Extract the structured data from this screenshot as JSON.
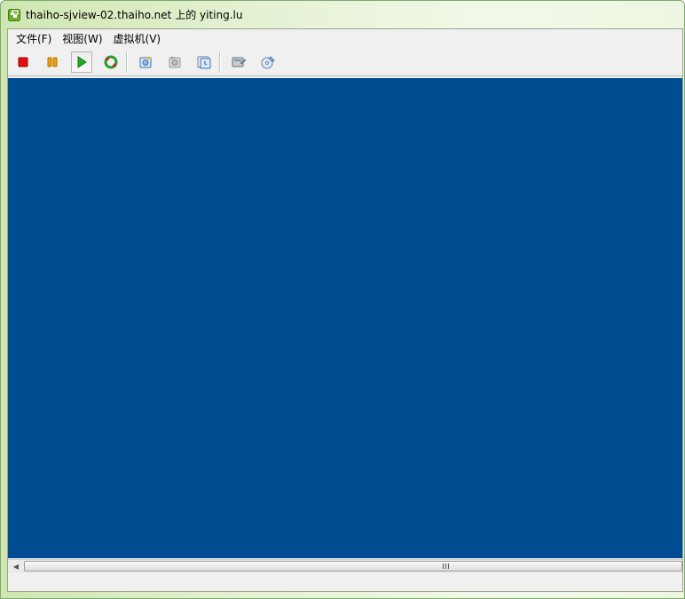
{
  "window": {
    "title": "thaiho-sjview-02.thaiho.net 上的 yiting.lu"
  },
  "menubar": {
    "items": [
      "文件(F)",
      "视图(W)",
      "虚拟机(V)"
    ]
  },
  "toolbar": {
    "buttons": [
      {
        "name": "power-off",
        "icon": "stop-square-icon",
        "color": "#e01010"
      },
      {
        "name": "suspend",
        "icon": "pause-icon",
        "color": "#f0a000"
      },
      {
        "name": "power-on",
        "icon": "play-icon",
        "color": "#20a020",
        "pressed": true
      },
      {
        "name": "reset",
        "icon": "refresh-icon",
        "color": "#2a9a2a"
      },
      {
        "name": "take-snapshot",
        "icon": "snapshot-take-icon"
      },
      {
        "name": "revert-snapshot",
        "icon": "snapshot-revert-icon",
        "disabled": true
      },
      {
        "name": "snapshot-manager",
        "icon": "snapshot-manager-icon"
      },
      {
        "name": "vm-settings",
        "icon": "vm-settings-icon"
      },
      {
        "name": "connect-devices",
        "icon": "cd-devices-icon"
      }
    ]
  },
  "console": {
    "background": "#004c93"
  }
}
